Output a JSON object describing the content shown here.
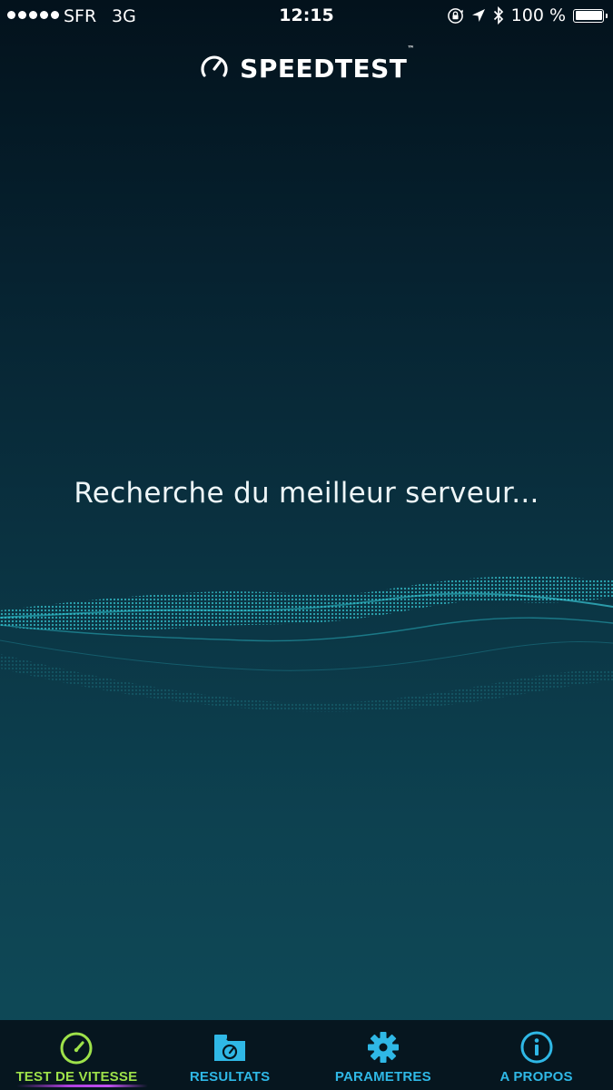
{
  "status_bar": {
    "carrier": "SFR",
    "network": "3G",
    "time": "12:15",
    "battery_percent_label": "100 %",
    "battery_level": 1.0,
    "signal_bars": 5,
    "icons": [
      "orientation-lock-icon",
      "location-arrow-icon",
      "bluetooth-icon",
      "battery-icon"
    ]
  },
  "header": {
    "logo_text": "SPEEDTEST",
    "logo_tm": "™",
    "logo_icon": "speedometer-icon"
  },
  "main": {
    "status_message": "Recherche du meilleur serveur..."
  },
  "tab_bar": {
    "tabs": [
      {
        "label": "TEST DE VITESSE",
        "icon": "speedometer-icon",
        "active": true
      },
      {
        "label": "RESULTATS",
        "icon": "folder-gauge-icon",
        "active": false
      },
      {
        "label": "PARAMETRES",
        "icon": "gear-icon",
        "active": false
      },
      {
        "label": "A PROPOS",
        "icon": "info-icon",
        "active": false
      }
    ]
  },
  "colors": {
    "tab_active": "#9ee24a",
    "tab_inactive": "#2fb8e6",
    "active_indicator": "#b040e0",
    "wave": "#2ec9d6",
    "background_top": "#03121c",
    "background_bottom": "#0f4b59"
  }
}
